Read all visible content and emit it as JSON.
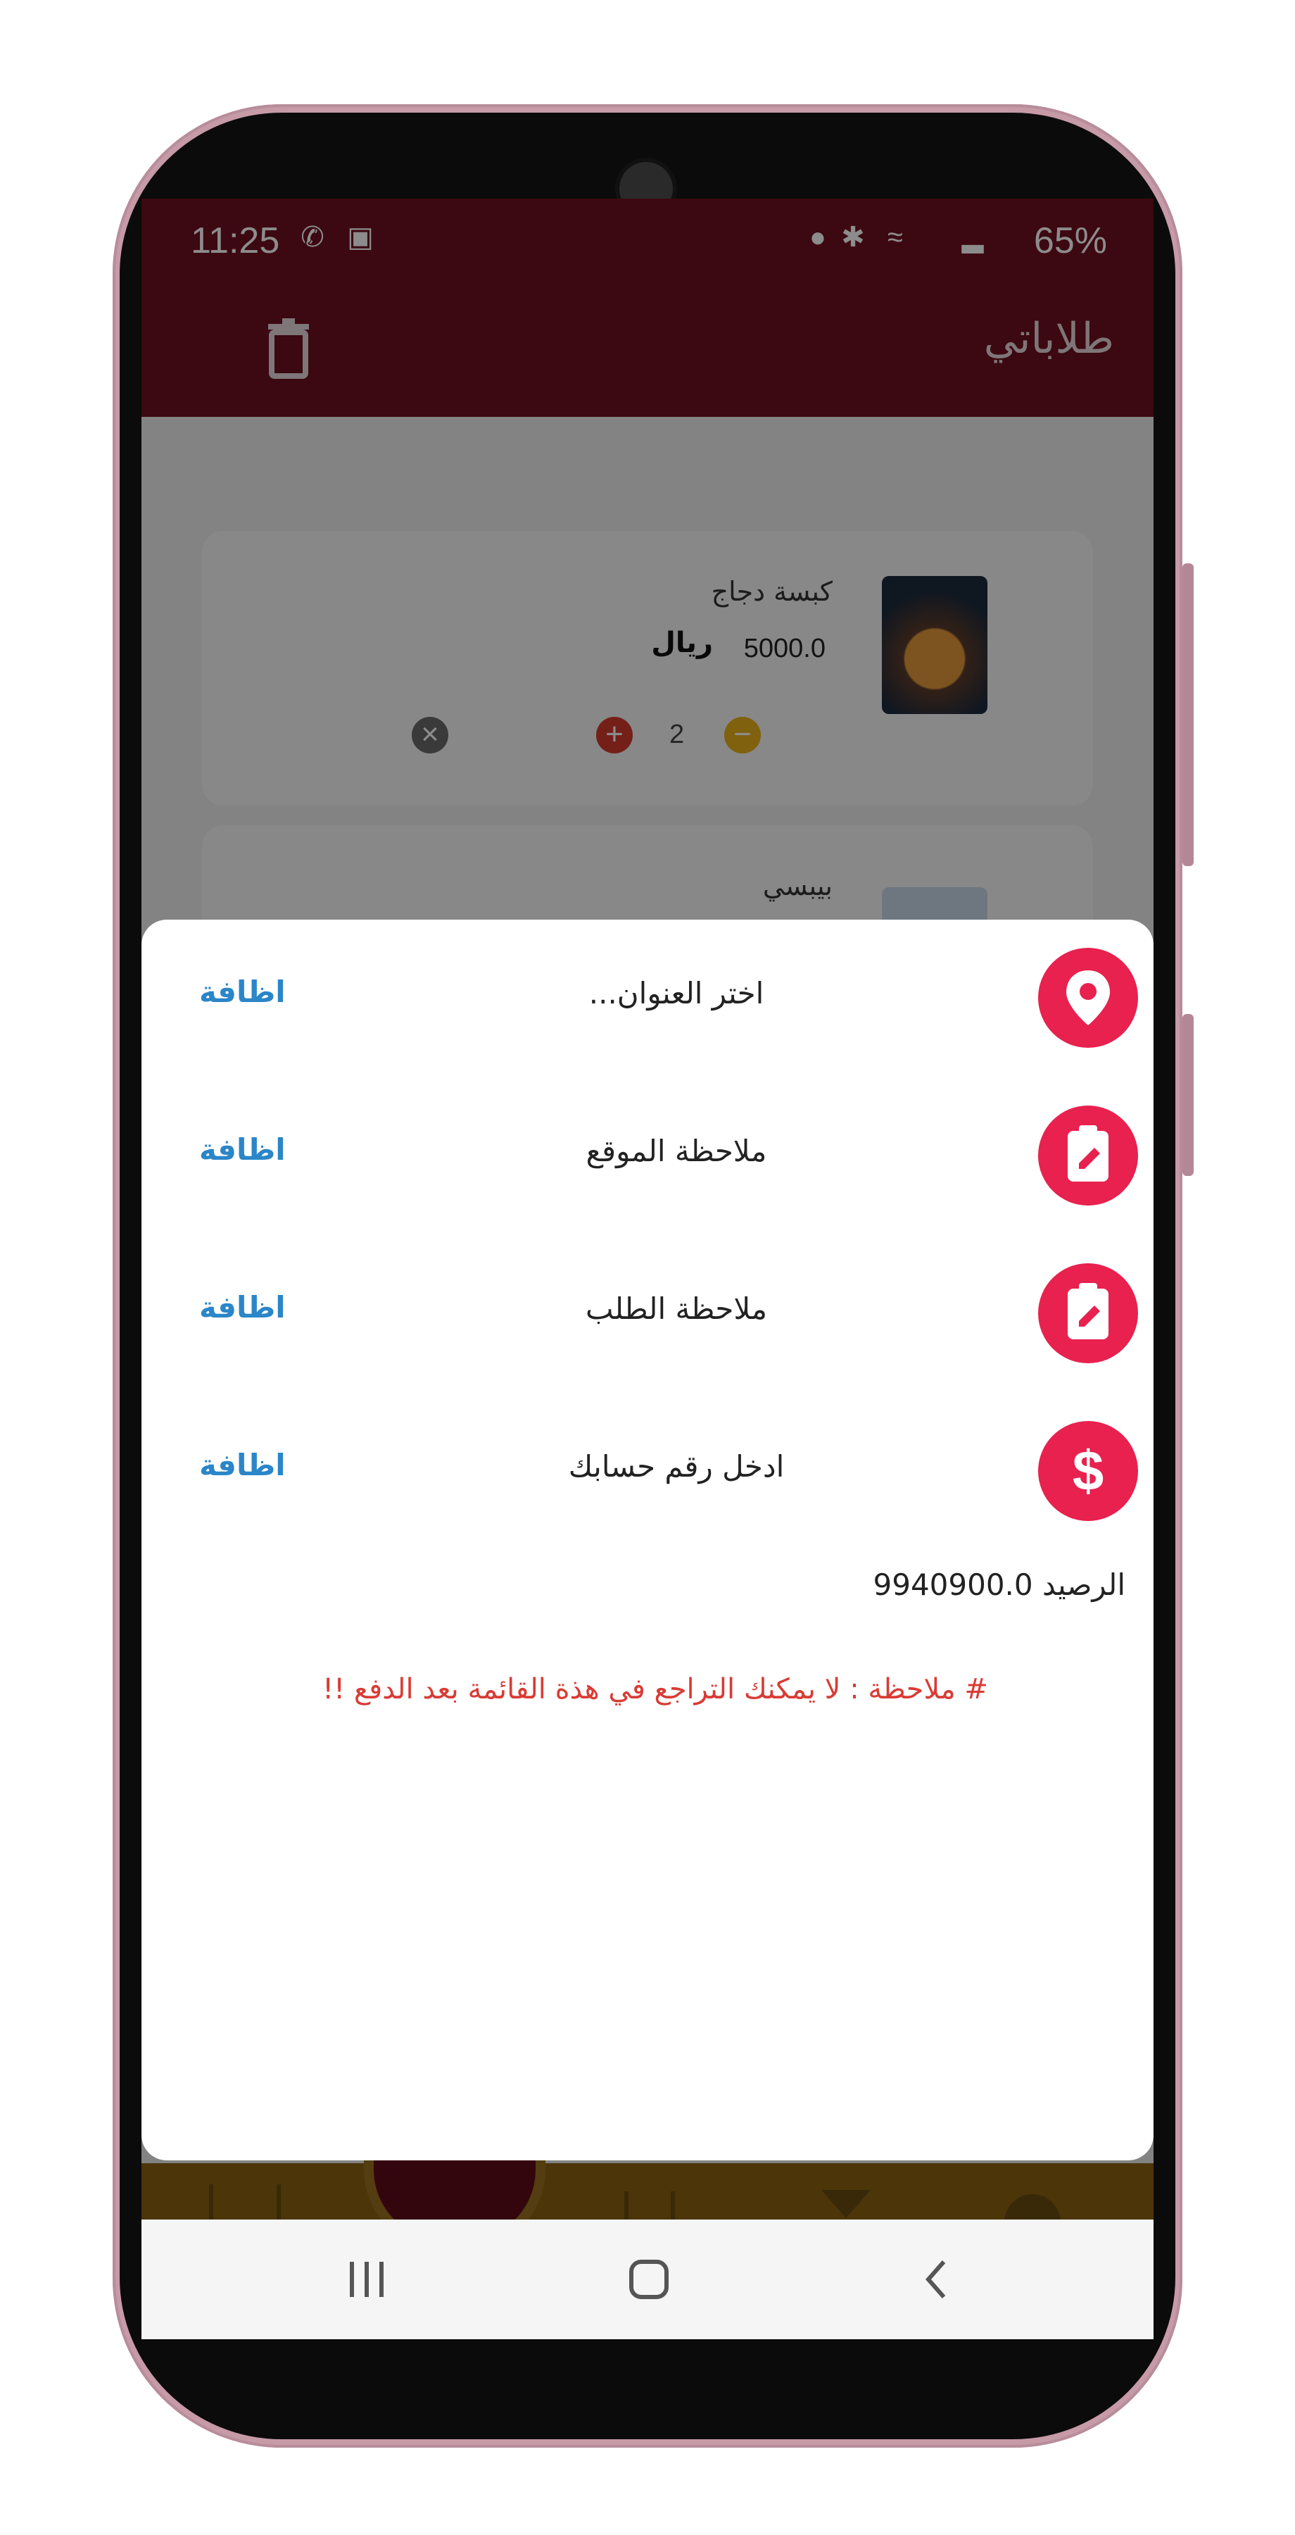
{
  "status_bar": {
    "time": "11:25",
    "battery": "65%"
  },
  "app_bar": {
    "title": "طلاباتي"
  },
  "cart": {
    "items": [
      {
        "name": "كبسة دجاج",
        "price": "5000.0",
        "currency": "ريال",
        "quantity": "2"
      },
      {
        "name": "بيبسي"
      }
    ]
  },
  "sheet": {
    "rows": [
      {
        "label": "اختر العنوان...",
        "action": "اظافة",
        "icon": "location-pin-icon"
      },
      {
        "label": "ملاحظة الموقع",
        "action": "اظافة",
        "icon": "clipboard-edit-icon"
      },
      {
        "label": "ملاحظة الطلب",
        "action": "اظافة",
        "icon": "clipboard-edit-icon"
      },
      {
        "label": "ادخل رقم حسابك",
        "action": "اظافة",
        "icon": "dollar-icon"
      }
    ],
    "balance": "الرصيد 9940900.0",
    "note": "# ملاحظة : لا يمكنك التراجع في هذة القائمة بعد الدفع !!"
  },
  "colors": {
    "app_bar": "#6e0f20",
    "accent": "#e8214f",
    "link": "#2a86c8",
    "warning": "#d93b34"
  }
}
